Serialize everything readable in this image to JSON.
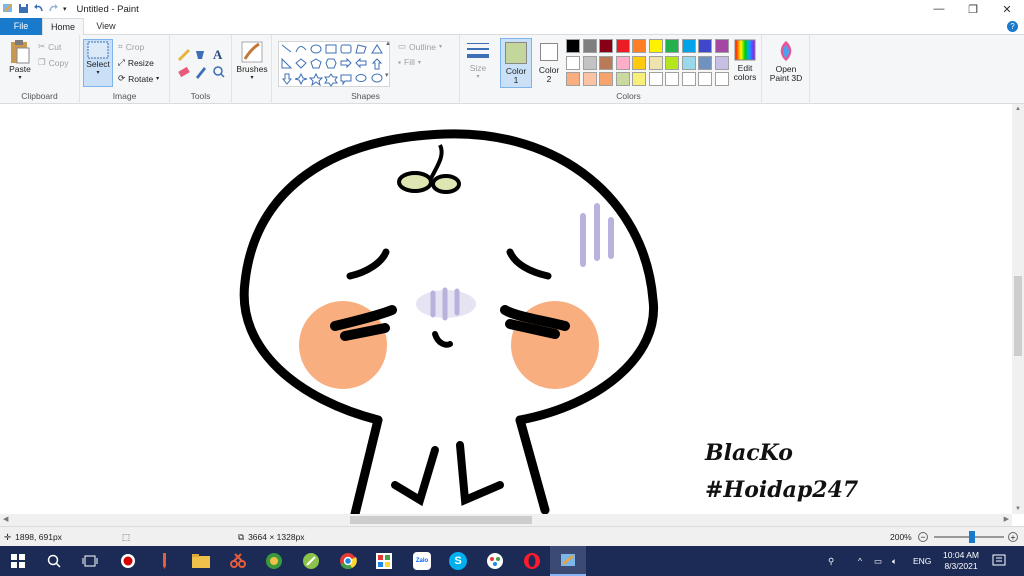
{
  "window": {
    "title": "Untitled - Paint"
  },
  "tabs": [
    {
      "label": "File"
    },
    {
      "label": "Home"
    },
    {
      "label": "View"
    }
  ],
  "ribbon": {
    "clipboard": {
      "label": "Clipboard",
      "paste": "Paste",
      "cut": "Cut",
      "copy": "Copy"
    },
    "image": {
      "label": "Image",
      "select": "Select",
      "crop": "Crop",
      "resize": "Resize",
      "rotate": "Rotate"
    },
    "tools": {
      "label": "Tools"
    },
    "brushes": {
      "label": "Brushes"
    },
    "shapes": {
      "label": "Shapes",
      "outline": "Outline",
      "fill": "Fill"
    },
    "size": {
      "label": "Size"
    },
    "colors": {
      "label": "Colors",
      "color1": "Color 1",
      "color1_line1": "Color",
      "color1_line2": "1",
      "color2_line1": "Color",
      "color2_line2": "2",
      "edit_line1": "Edit",
      "edit_line2": "colors",
      "primary": "#c3d69b",
      "secondary": "#ffffff",
      "palette_row1": [
        "#000000",
        "#7f7f7f",
        "#880015",
        "#ed1c24",
        "#ff7f27",
        "#fff200",
        "#22b14c",
        "#00a2e8",
        "#3f48cc",
        "#a349a4"
      ],
      "palette_row2": [
        "#ffffff",
        "#c3c3c3",
        "#b97a57",
        "#ffaec9",
        "#ffc90e",
        "#efe4b0",
        "#b5e61d",
        "#99d9ea",
        "#7092be",
        "#c8bfe7"
      ],
      "palette_row3": [
        "#f8ae7e",
        "#fbc3a3",
        "#f7a46c",
        "#c9d99f",
        "#f6ef7a",
        "#ffffff",
        "#ffffff",
        "#ffffff",
        "#ffffff",
        "#ffffff"
      ]
    },
    "paint3d": {
      "line1": "Open",
      "line2": "Paint 3D"
    }
  },
  "canvas": {
    "signature_line1": "BlacKo",
    "signature_line2": "#Hoidap247"
  },
  "status": {
    "cursor": "1898, 691px",
    "size": "3664 × 1328px",
    "zoom": "200%",
    "zoom_fraction": 0.55
  },
  "taskbar": {
    "apps": [
      "windows-start",
      "search",
      "task-view",
      "record",
      "pencil-app",
      "file-explorer",
      "snipping",
      "paint-3d",
      "chrome",
      "photos",
      "zalo",
      "skype",
      "paint-app-2",
      "opera",
      "paint"
    ],
    "zalo_label": "Zalo",
    "lang": "ENG",
    "time": "10:04 AM",
    "date": "8/3/2021"
  }
}
